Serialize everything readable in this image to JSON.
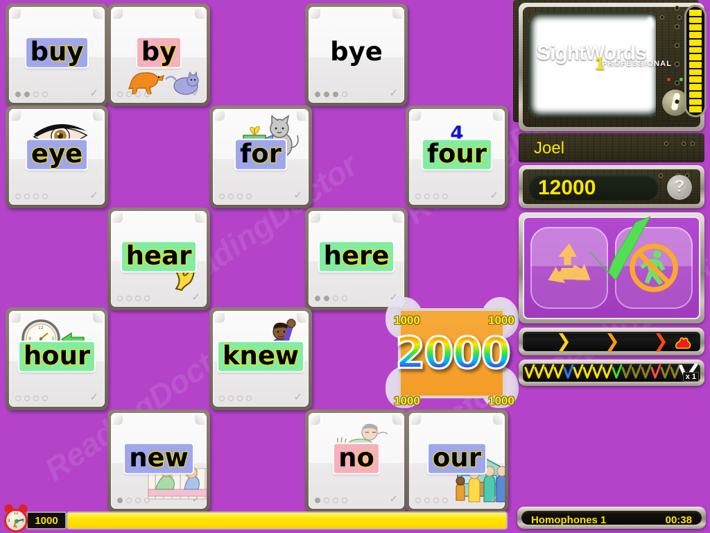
{
  "background_color": "#b443c9",
  "watermark_text": "ReadingDoctor",
  "grid": {
    "cards": [
      {
        "word": "buy",
        "highlight": "blue",
        "plain_prefix": "b",
        "outlined_suffix": "uy",
        "dots_total": 4,
        "dots_filled": 2,
        "picture": "none",
        "col": 0,
        "row": 0
      },
      {
        "word": "by",
        "highlight": "pink",
        "plain_prefix": "b",
        "outlined_suffix": "y",
        "dots_total": 4,
        "dots_filled": 0,
        "picture": "dog-and-cat",
        "col": 1,
        "row": 0
      },
      {
        "word": "bye",
        "highlight": "none",
        "plain_prefix": "bye",
        "outlined_suffix": "",
        "dots_total": 4,
        "dots_filled": 3,
        "picture": "none",
        "col": 3,
        "row": 0
      },
      {
        "word": "eye",
        "highlight": "blue",
        "plain_prefix": "",
        "outlined_suffix": "eye",
        "dots_total": 4,
        "dots_filled": 0,
        "picture": "eye",
        "col": 0,
        "row": 1
      },
      {
        "word": "for",
        "highlight": "blue",
        "plain_prefix": "f",
        "outlined_suffix": "or",
        "dots_total": 4,
        "dots_filled": 0,
        "picture": "cat-gift",
        "col": 2,
        "row": 1
      },
      {
        "word": "four",
        "highlight": "green",
        "plain_prefix": "f",
        "outlined_suffix": "our",
        "dots_total": 4,
        "dots_filled": 0,
        "picture": "numeral-4",
        "col": 4,
        "row": 1
      },
      {
        "word": "hear",
        "highlight": "green",
        "plain_prefix": "",
        "outlined_suffix": "hear",
        "dots_total": 4,
        "dots_filled": 0,
        "picture": "ear",
        "col": 1,
        "row": 2
      },
      {
        "word": "here",
        "highlight": "green",
        "plain_prefix": "h",
        "outlined_suffix": "ere",
        "dots_total": 4,
        "dots_filled": 2,
        "picture": "none",
        "col": 3,
        "row": 2
      },
      {
        "word": "hour",
        "highlight": "green",
        "plain_prefix": "",
        "outlined_suffix": "hour",
        "dots_total": 4,
        "dots_filled": 0,
        "picture": "clock-arrow",
        "col": 0,
        "row": 3
      },
      {
        "word": "knew",
        "highlight": "green",
        "plain_prefix": "",
        "outlined_suffix": "knew",
        "dots_total": 4,
        "dots_filled": 0,
        "picture": "boy-raised-arm",
        "col": 2,
        "row": 3
      },
      {
        "word": "new",
        "highlight": "blue",
        "plain_prefix": "n",
        "outlined_suffix": "ew",
        "dots_total": 4,
        "dots_filled": 1,
        "picture": "baby-crib",
        "col": 1,
        "row": 4
      },
      {
        "word": "no",
        "highlight": "pink",
        "plain_prefix": "n",
        "outlined_suffix": "o",
        "dots_total": 4,
        "dots_filled": 1,
        "picture": "boy-sleeping",
        "col": 3,
        "row": 4
      },
      {
        "word": "our",
        "highlight": "blue",
        "plain_prefix": "",
        "outlined_suffix": "our",
        "dots_total": 4,
        "dots_filled": 0,
        "picture": "family-house",
        "col": 4,
        "row": 4
      }
    ],
    "numeral_label": "4"
  },
  "score_burst": {
    "main_value": "2000",
    "corner_values": [
      "1000",
      "1000",
      "1000",
      "1000"
    ],
    "panel_color": "#f49c26"
  },
  "bottom_timer": {
    "value": "1000",
    "bar_fill_percent": 100,
    "bar_color": "#ffe600",
    "clock_numbers": {
      "twelve": "12",
      "three": "3",
      "six": "6",
      "nine": "9"
    }
  },
  "sidebar": {
    "tv": {
      "screen_state": "blank-white"
    },
    "player_name": "Joel",
    "score": "12000",
    "help_label": "?",
    "powerups": [
      {
        "name": "recycle",
        "label": "recycle-powerup",
        "color": "#f8c35e",
        "checked": true
      },
      {
        "name": "no-walking",
        "label": "no-walking-powerup",
        "color": "#f8a92e",
        "checked": false
      }
    ],
    "speed_bar": {
      "chevrons": [
        {
          "color": "#ffd21e"
        },
        {
          "color": "#ff9a12"
        },
        {
          "color": "#ff4a10"
        }
      ],
      "rabbit_color": "#ee1c1c"
    },
    "zigzag_bar": {
      "multiplier": "x 1",
      "check_colors": [
        "#ffe400",
        "#ffe400",
        "#ffe400",
        "#ffe400",
        "#2a7bff",
        "#ffe400",
        "#ffe400",
        "#ffe400",
        "#ffe400",
        "#3bdb3b"
      ],
      "dim_colors": [
        "#8a8320",
        "#8a8320",
        "#8a8320",
        "#ff4a4a",
        "#8a8320",
        "#8a8320",
        "#8a8320"
      ],
      "final_check_color": "#ffffff"
    },
    "logo": {
      "main": "SightWords",
      "numeral": "1",
      "sub": "PROFESSIONAL"
    },
    "gauge": {
      "segments": 14,
      "filled": 14,
      "color": "#ffe400"
    },
    "status": {
      "lesson": "Homophones 1",
      "time": "00:38"
    }
  }
}
